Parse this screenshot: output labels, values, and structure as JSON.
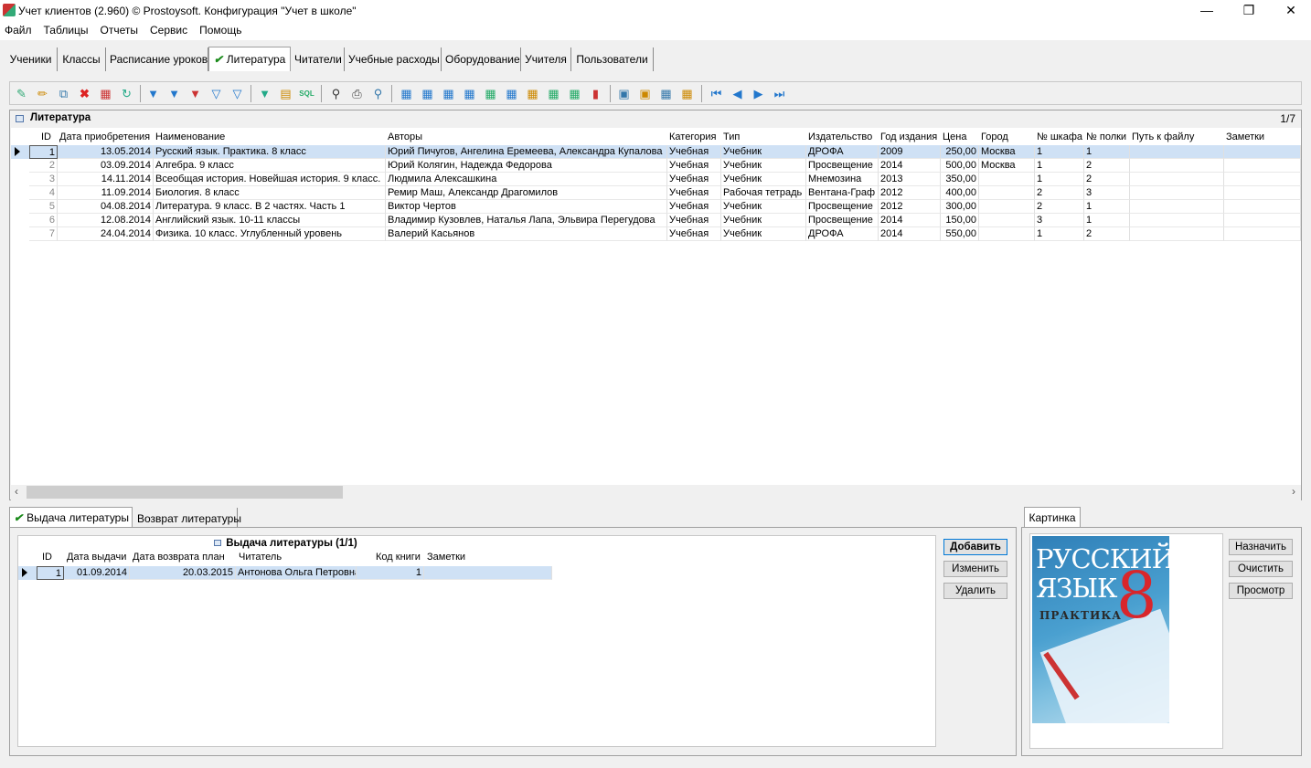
{
  "window": {
    "title": "Учет клиентов (2.960) © Prostoysoft. Конфигурация \"Учет в школе\""
  },
  "menu": [
    "Файл",
    "Таблицы",
    "Отчеты",
    "Сервис",
    "Помощь"
  ],
  "tabs": [
    {
      "label": "Ученики",
      "active": false
    },
    {
      "label": "Классы",
      "active": false
    },
    {
      "label": "Расписание уроков",
      "active": false
    },
    {
      "label": "Литература",
      "active": true
    },
    {
      "label": "Читатели",
      "active": false
    },
    {
      "label": "Учебные расходы",
      "active": false
    },
    {
      "label": "Оборудование",
      "active": false
    },
    {
      "label": "Учителя",
      "active": false
    },
    {
      "label": "Пользователи",
      "active": false
    }
  ],
  "grid": {
    "title": "Литература",
    "count": "1/7",
    "columns": [
      "ID",
      "Дата приобретения",
      "Наименование",
      "Авторы",
      "Категория",
      "Тип",
      "Издательство",
      "Год издания",
      "Цена",
      "Город",
      "№ шкафа",
      "№ полки",
      "Путь к файлу",
      "Заметки"
    ],
    "rows": [
      [
        "1",
        "13.05.2014",
        "Русский язык. Практика. 8 класс",
        "Юрий Пичугов, Ангелина Еремеева, Александра Купалова",
        "Учебная",
        "Учебник",
        "ДРОФА",
        "2009",
        "250,00",
        "Москва",
        "1",
        "1",
        "",
        ""
      ],
      [
        "2",
        "03.09.2014",
        "Алгебра. 9 класс",
        "Юрий Колягин, Надежда Федорова",
        "Учебная",
        "Учебник",
        "Просвещение",
        "2014",
        "500,00",
        "Москва",
        "1",
        "2",
        "",
        ""
      ],
      [
        "3",
        "14.11.2014",
        "Всеобщая история. Новейшая история. 9 класс.",
        "Людмила Алексашкина",
        "Учебная",
        "Учебник",
        "Мнемозина",
        "2013",
        "350,00",
        "",
        "1",
        "2",
        "",
        ""
      ],
      [
        "4",
        "11.09.2014",
        "Биология. 8 класс",
        "Ремир Маш, Александр Драгомилов",
        "Учебная",
        "Рабочая тетрадь",
        "Вентана-Граф",
        "2012",
        "400,00",
        "",
        "2",
        "3",
        "",
        ""
      ],
      [
        "5",
        "04.08.2014",
        "Литература. 9 класс. В 2 частях. Часть 1",
        "Виктор Чертов",
        "Учебная",
        "Учебник",
        "Просвещение",
        "2012",
        "300,00",
        "",
        "2",
        "1",
        "",
        ""
      ],
      [
        "6",
        "12.08.2014",
        "Английский язык. 10-11 классы",
        "Владимир Кузовлев, Наталья Лапа, Эльвира Перегудова",
        "Учебная",
        "Учебник",
        "Просвещение",
        "2014",
        "150,00",
        "",
        "3",
        "1",
        "",
        ""
      ],
      [
        "7",
        "24.04.2014",
        "Физика. 10 класс. Углубленный уровень",
        "Валерий Касьянов",
        "Учебная",
        "Учебник",
        "ДРОФА",
        "2014",
        "550,00",
        "",
        "1",
        "2",
        "",
        ""
      ]
    ]
  },
  "lower_tabs": [
    {
      "label": "Выдача литературы",
      "active": true
    },
    {
      "label": "Возврат литературы",
      "active": false
    }
  ],
  "subgrid": {
    "title": "Выдача литературы (1/1)",
    "columns": [
      "ID",
      "Дата выдачи",
      "Дата возврата план",
      "Читатель",
      "Код книги",
      "Заметки"
    ],
    "rows": [
      [
        "1",
        "01.09.2014",
        "20.03.2015",
        "Антонова Ольга Петровна",
        "1",
        ""
      ]
    ]
  },
  "buttons": {
    "add": "Добавить",
    "edit": "Изменить",
    "delete": "Удалить"
  },
  "picture": {
    "tab": "Картинка",
    "assign": "Назначить",
    "clear": "Очистить",
    "view": "Просмотр",
    "cover_line1": "РУССКИЙ",
    "cover_line2": "ЯЗЫК",
    "cover_grade": "8",
    "cover_line3": "ПРАКТИКА"
  },
  "colors": {
    "selected_row": "#cfe1f5",
    "accent": "#0078d7",
    "check": "#1a8a1a"
  }
}
